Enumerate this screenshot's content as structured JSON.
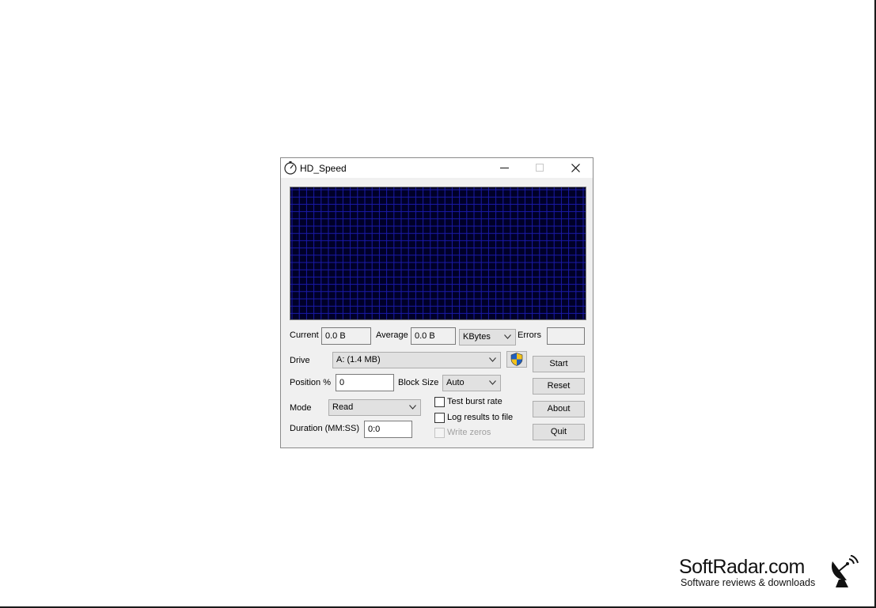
{
  "window": {
    "title": "HD_Speed"
  },
  "stats": {
    "current_label": "Current",
    "current_value": "0.0 B",
    "average_label": "Average",
    "average_value": "0.0 B",
    "unit_selected": "KBytes",
    "errors_label": "Errors",
    "errors_value": ""
  },
  "drive": {
    "label": "Drive",
    "selected": "A: (1.4 MB)"
  },
  "position": {
    "label": "Position %",
    "value": "0"
  },
  "block_size": {
    "label": "Block Size",
    "selected": "Auto"
  },
  "mode": {
    "label": "Mode",
    "selected": "Read"
  },
  "duration": {
    "label": "Duration (MM:SS)",
    "value": "0:0"
  },
  "options": {
    "test_burst_rate": {
      "label": "Test burst rate",
      "checked": false
    },
    "log_results": {
      "label": "Log results to file",
      "checked": false
    },
    "write_zeros": {
      "label": "Write zeros",
      "checked": false,
      "disabled": true
    }
  },
  "buttons": {
    "start": "Start",
    "reset": "Reset",
    "about": "About",
    "quit": "Quit"
  },
  "colors": {
    "graph_bg": "#000028",
    "graph_grid": "#1a1aa8",
    "window_bg": "#f0f0f0"
  },
  "watermark": {
    "title": "SoftRadar.com",
    "subtitle": "Software reviews & downloads"
  }
}
